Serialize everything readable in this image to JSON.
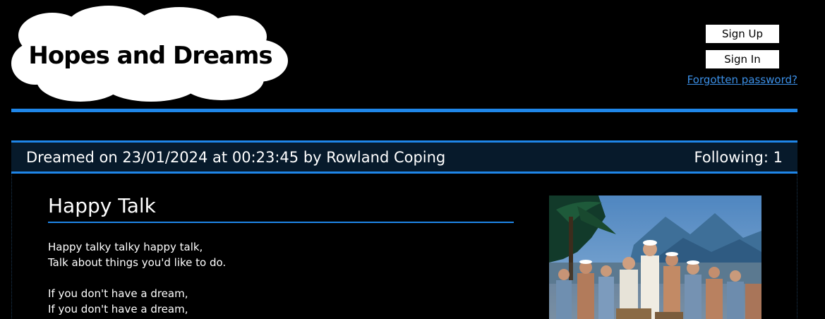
{
  "header": {
    "logo_text": "Hopes and Dreams",
    "signup_label": "Sign Up",
    "signin_label": "Sign In",
    "forgot_label": "Forgotten password?"
  },
  "dream": {
    "meta": "Dreamed on 23/01/2024 at 00:23:45 by Rowland Coping",
    "following": "Following: 1",
    "title": "Happy Talk",
    "lyrics": [
      "Happy talky talky happy talk,",
      "Talk about things you'd like to do.",
      "",
      "If you don't have a dream,",
      "If you don't have a dream,"
    ]
  },
  "colors": {
    "accent": "#1f86e8",
    "link": "#3b8fe6",
    "bar_bg": "#071a2b",
    "background": "#000000"
  }
}
